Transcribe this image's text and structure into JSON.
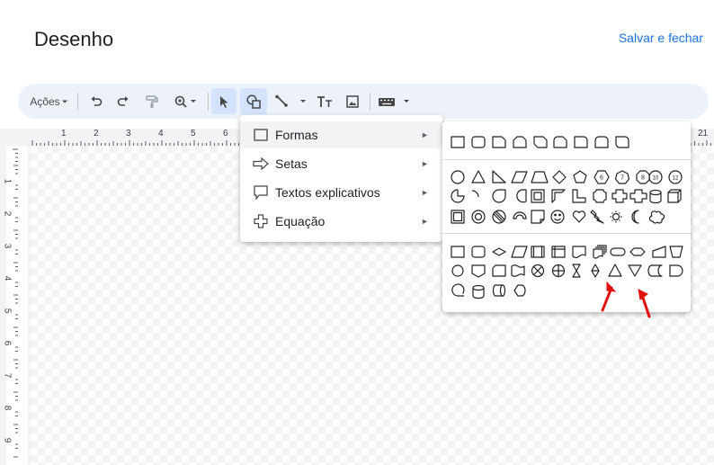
{
  "header": {
    "title": "Desenho",
    "save_label": "Salvar e fechar"
  },
  "toolbar": {
    "actions_label": "Ações"
  },
  "ruler": {
    "top_numbers": [
      "1",
      "2",
      "3",
      "4",
      "5",
      "6",
      "21"
    ],
    "left_numbers": [
      "1",
      "2",
      "3",
      "4",
      "5",
      "6",
      "7",
      "8",
      "9"
    ]
  },
  "shape_menu": {
    "items": [
      {
        "label": "Formas",
        "icon": "rectangle-icon"
      },
      {
        "label": "Setas",
        "icon": "arrow-icon"
      },
      {
        "label": "Textos explicativos",
        "icon": "callout-icon"
      },
      {
        "label": "Equação",
        "icon": "plus-icon"
      }
    ],
    "submenu_arrow": "►"
  },
  "shapes_submenu": {
    "rows": [
      [
        "rectangle",
        "rounded-rectangle",
        "snip-corner-rectangle",
        "snip-same-side-rectangle",
        "snip-diagonal-rectangle",
        "snip-round-rectangle",
        "round-corner-rectangle",
        "round-same-side-rectangle",
        "round-diagonal-rectangle"
      ],
      [
        "ellipse",
        "triangle",
        "right-triangle",
        "parallelogram",
        "trapezoid",
        "diamond",
        "pentagon",
        "hexagon",
        "heptagon",
        "octagon",
        "decagon",
        "dodecagon"
      ],
      [
        "pie",
        "arc",
        "teardrop",
        "chord",
        "frame",
        "half-frame",
        "l-shape",
        "plaque",
        "cross",
        "plus",
        "can",
        "cube"
      ],
      [
        "bevel",
        "donut",
        "no-symbol",
        "block-arc",
        "folded-corner",
        "smiley",
        "heart",
        "lightning-bolt",
        "sun",
        "moon",
        "cloud"
      ],
      [
        "process",
        "alternate-process",
        "decision",
        "data",
        "predefined-process",
        "internal-storage",
        "document",
        "multidocument",
        "terminator",
        "preparation",
        "manual-input",
        "manual-operation"
      ],
      [
        "connector",
        "off-page-connector",
        "card",
        "punched-tape",
        "summing-junction",
        "or",
        "collate",
        "sort",
        "extract",
        "merge",
        "stored-data",
        "delay"
      ],
      [
        "sequential-access-storage",
        "magnetic-disk",
        "direct-access-storage",
        "display"
      ]
    ],
    "polygon_labels": [
      "6",
      "7",
      "8",
      "10",
      "12"
    ]
  }
}
